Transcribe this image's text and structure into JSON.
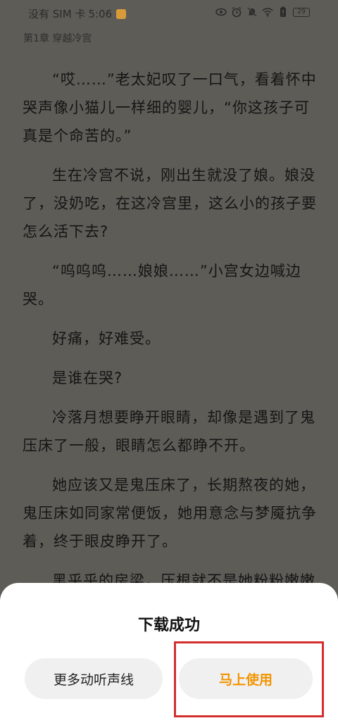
{
  "status_bar": {
    "carrier": "没有 SIM 卡",
    "time": "5:06",
    "battery": "29",
    "icons": [
      "eye-icon",
      "alarm-icon",
      "mute-icon",
      "wifi-icon",
      "battery-saver-icon",
      "battery-icon"
    ]
  },
  "reader": {
    "chapter_title": "第1章 穿越冷宫",
    "paragraphs": [
      "“哎……”老太妃叹了一口气，看着怀中哭声像小猫儿一样细的婴儿，“你这孩子可真是个命苦的。”",
      "生在冷宫不说，刚出生就没了娘。娘没了，没奶吃，在这冷宫里，这么小的孩子要怎么活下去?",
      "“呜呜呜……娘娘……”小宫女边喊边哭。",
      "好痛，好难受。",
      "是谁在哭?",
      "冷落月想要睁开眼睛，却像是遇到了鬼压床了一般，眼睛怎么都睁不开。",
      "她应该又是鬼压床了，长期熬夜的她，鬼压床如同家常便饭，她用意念与梦魇抗争着，终于眼皮睁开了。",
      "黑乎乎的房梁，压根就不是她粉粉嫩嫩"
    ]
  },
  "dialog": {
    "title": "下载成功",
    "more_voices_label": "更多动听声线",
    "use_now_label": "马上使用"
  },
  "colors": {
    "accent": "#f39400",
    "highlight": "#d32f2f",
    "overlay_bg": "#5d5c57"
  }
}
